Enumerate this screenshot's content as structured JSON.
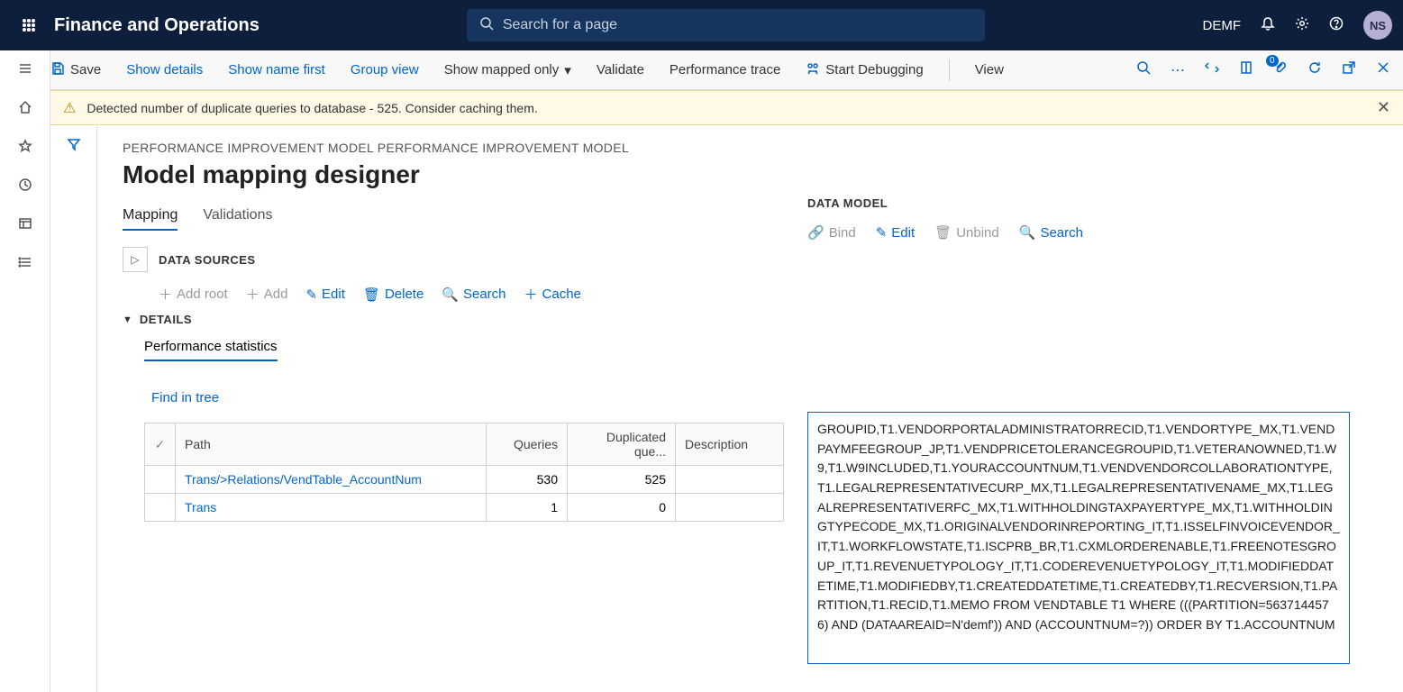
{
  "header": {
    "app_title": "Finance and Operations",
    "search_placeholder": "Search for a page",
    "company": "DEMF",
    "user_initials": "NS"
  },
  "command_bar": {
    "save": "Save",
    "show_details": "Show details",
    "show_name_first": "Show name first",
    "group_view": "Group view",
    "show_mapped_only": "Show mapped only",
    "validate": "Validate",
    "performance_trace": "Performance trace",
    "start_debugging": "Start Debugging",
    "view": "View",
    "attach_badge": "0"
  },
  "warning": {
    "text": "Detected number of duplicate queries to database - 525. Consider caching them."
  },
  "page": {
    "breadcrumb": "PERFORMANCE IMPROVEMENT MODEL PERFORMANCE IMPROVEMENT MODEL",
    "title": "Model mapping designer",
    "tabs": {
      "mapping": "Mapping",
      "validations": "Validations"
    },
    "data_sources_label": "DATA SOURCES",
    "ds_actions": {
      "add_root": "Add root",
      "add": "Add",
      "edit": "Edit",
      "delete": "Delete",
      "search": "Search",
      "cache": "Cache"
    },
    "details_label": "DETAILS",
    "perf_tab": "Performance statistics",
    "find_in_tree": "Find in tree",
    "table": {
      "headers": {
        "path": "Path",
        "queries": "Queries",
        "dup": "Duplicated que...",
        "desc": "Description"
      },
      "rows": [
        {
          "path": "Trans/>Relations/VendTable_AccountNum",
          "queries": "530",
          "dup": "525",
          "desc": ""
        },
        {
          "path": "Trans",
          "queries": "1",
          "dup": "0",
          "desc": ""
        }
      ]
    }
  },
  "data_model": {
    "label": "DATA MODEL",
    "actions": {
      "bind": "Bind",
      "edit": "Edit",
      "unbind": "Unbind",
      "search": "Search"
    },
    "sql": "GROUPID,T1.VENDORPORTALADMINISTRATORRECID,T1.VENDORTYPE_MX,T1.VENDPAYMFEEGROUP_JP,T1.VENDPRICETOLERANCEGROUPID,T1.VETERANOWNED,T1.W9,T1.W9INCLUDED,T1.YOURACCOUNTNUM,T1.VENDVENDORCOLLABORATIONTYPE,T1.LEGALREPRESENTATIVECURP_MX,T1.LEGALREPRESENTATIVENAME_MX,T1.LEGALREPRESENTATIVERFC_MX,T1.WITHHOLDINGTAXPAYERTYPE_MX,T1.WITHHOLDINGTYPECODE_MX,T1.ORIGINALVENDORINREPORTING_IT,T1.ISSELFINVOICEVENDOR_IT,T1.WORKFLOWSTATE,T1.ISCPRB_BR,T1.CXMLORDERENABLE,T1.FREENOTESGROUP_IT,T1.REVENUETYPOLOGY_IT,T1.CODEREVENUETYPOLOGY_IT,T1.MODIFIEDDATETIME,T1.MODIFIEDBY,T1.CREATEDDATETIME,T1.CREATEDBY,T1.RECVERSION,T1.PARTITION,T1.RECID,T1.MEMO FROM VENDTABLE T1 WHERE (((PARTITION=5637144576) AND (DATAAREAID=N'demf')) AND (ACCOUNTNUM=?)) ORDER BY T1.ACCOUNTNUM"
  }
}
